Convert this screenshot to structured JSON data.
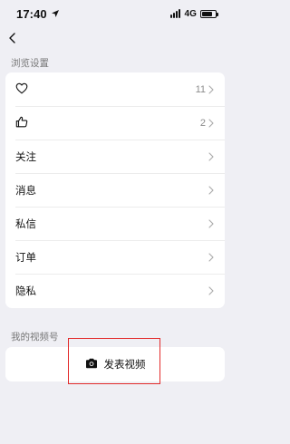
{
  "status_bar": {
    "time": "17:40",
    "network": "4G",
    "battery_percent": 80
  },
  "sections": {
    "browse_settings_label": "浏览设置",
    "my_channel_label": "我的视频号"
  },
  "settings_rows": [
    {
      "icon": "heart-icon",
      "label": "",
      "count": "11"
    },
    {
      "icon": "thumbs-up-icon",
      "label": "",
      "count": "2"
    },
    {
      "icon": "",
      "label": "关注",
      "count": ""
    },
    {
      "icon": "",
      "label": "消息",
      "count": ""
    },
    {
      "icon": "",
      "label": "私信",
      "count": ""
    },
    {
      "icon": "",
      "label": "订单",
      "count": ""
    },
    {
      "icon": "",
      "label": "隐私",
      "count": ""
    }
  ],
  "video_channel": {
    "publish_label": "发表视频",
    "publish_icon": "camera-icon"
  },
  "colors": {
    "background": "#efeff4",
    "card": "#ffffff",
    "highlight_border": "#e22b2b"
  }
}
